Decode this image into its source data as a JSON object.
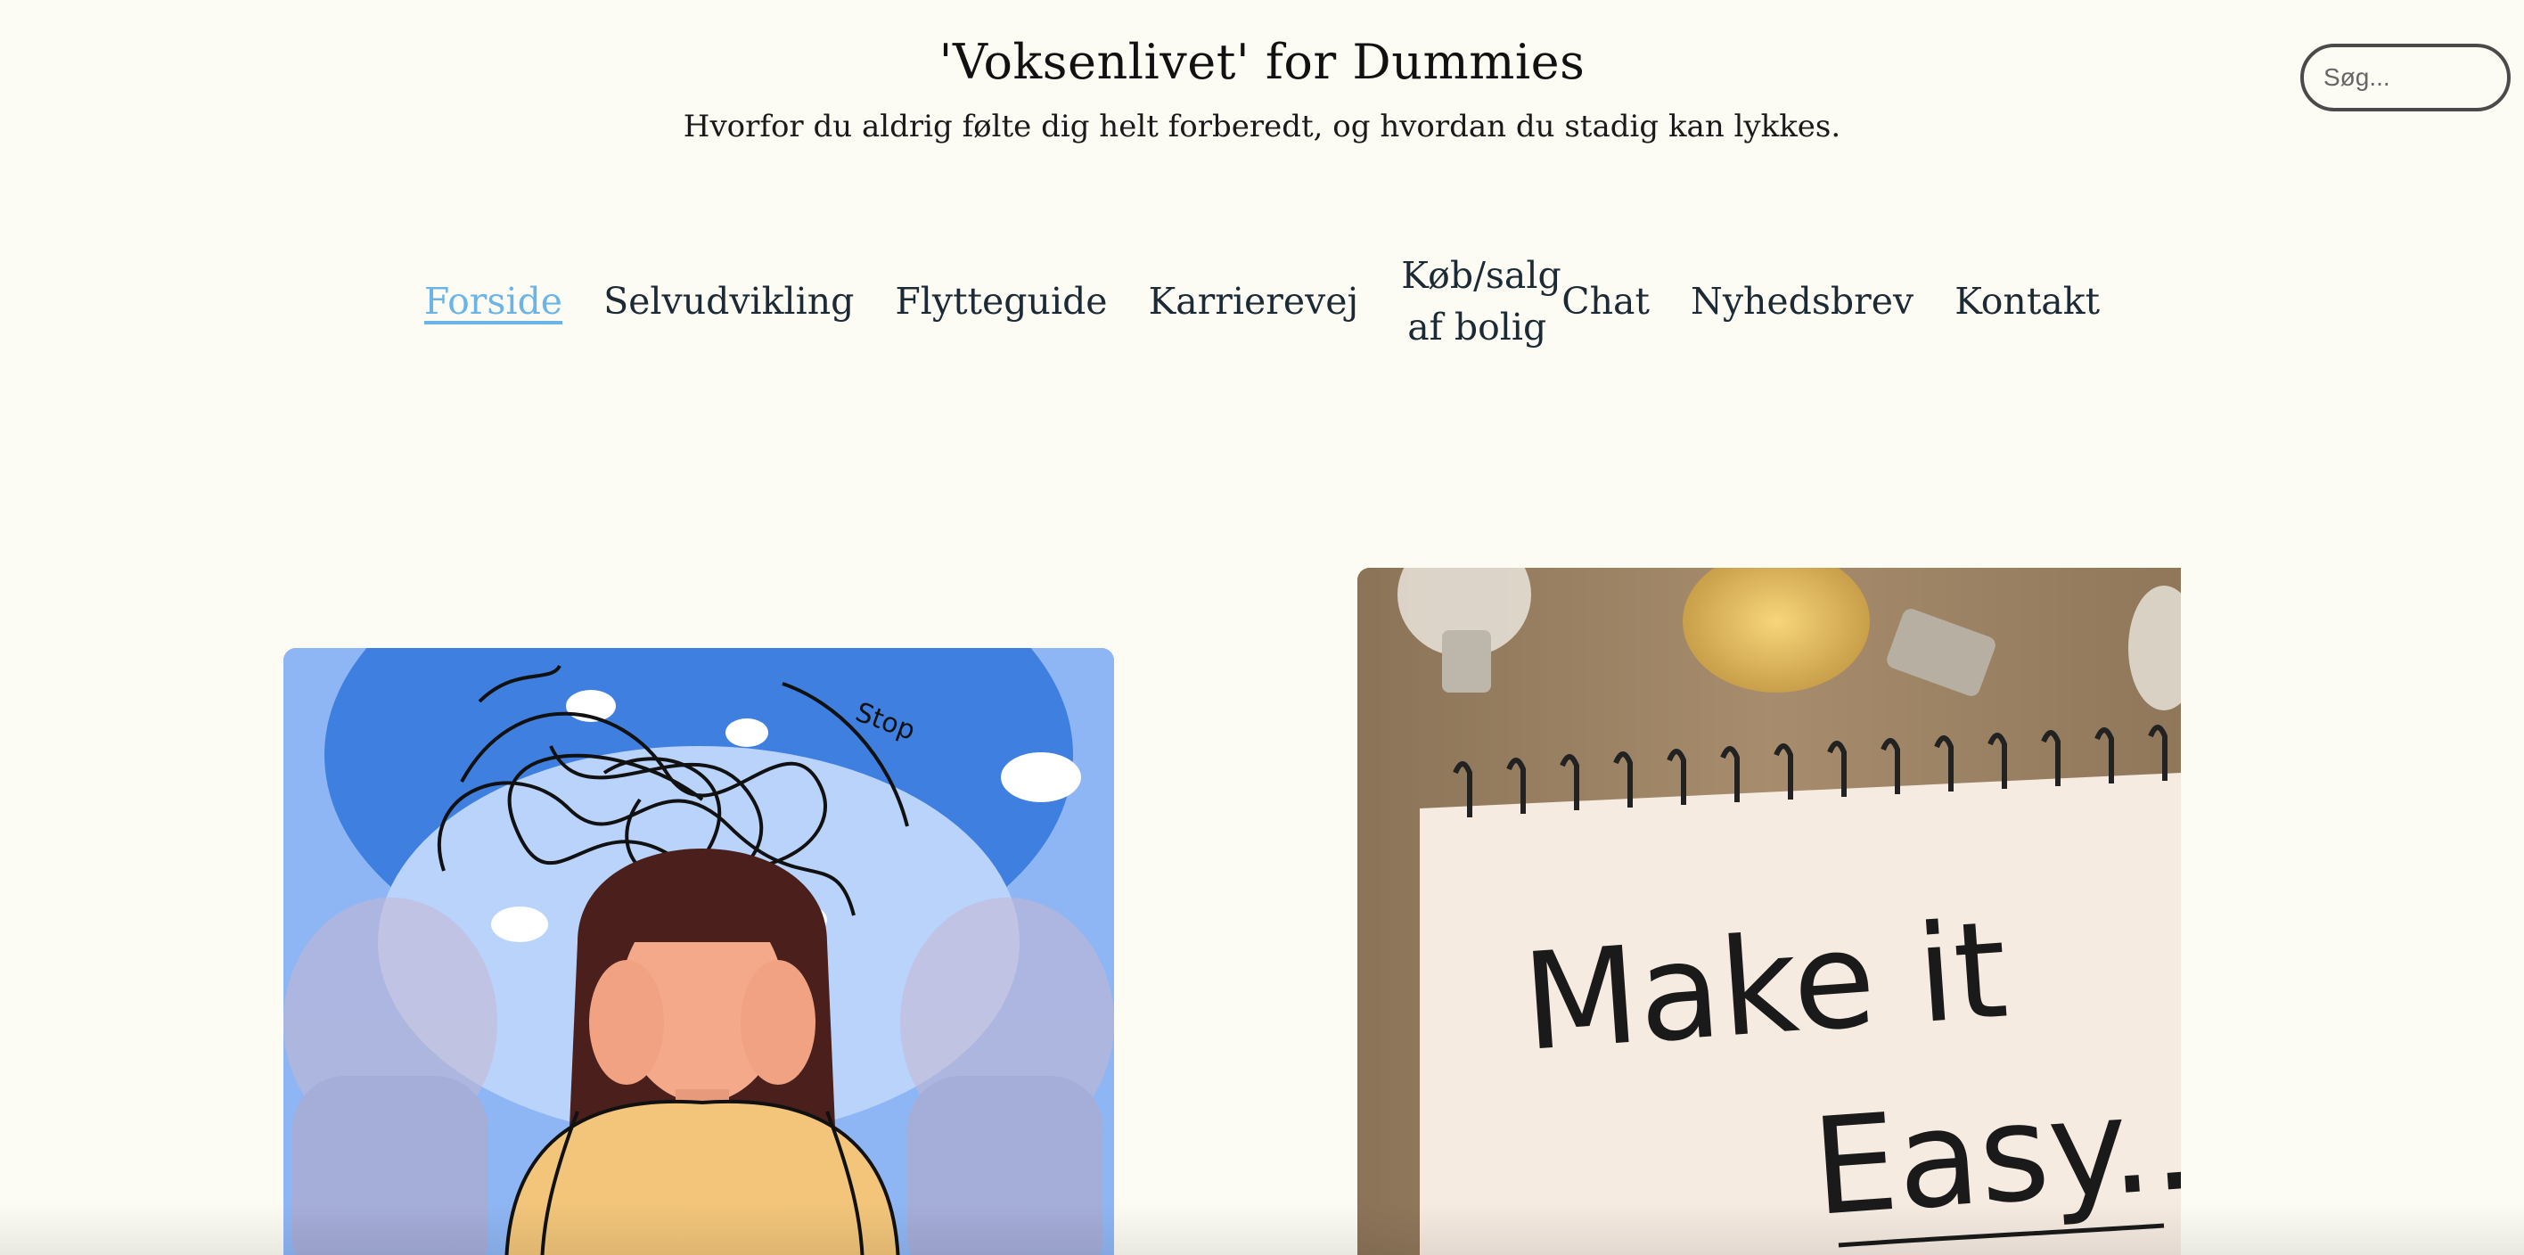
{
  "header": {
    "title": "'Voksenlivet' for Dummies",
    "subtitle": "Hvorfor du aldrig følte dig helt forberedt, og hvordan du stadig kan lykkes."
  },
  "search": {
    "placeholder": "Søg..."
  },
  "nav": {
    "items": [
      {
        "label": "Forside",
        "active": true
      },
      {
        "label": "Selvudvikling"
      },
      {
        "label": "Flytteguide"
      },
      {
        "label": "Karrierevej"
      },
      {
        "label": "Køb/salg af bolig"
      },
      {
        "label": "Chat"
      },
      {
        "label": "Nyhedsbrev"
      },
      {
        "label": "Kontakt"
      }
    ]
  },
  "cards": {
    "right_image_text_line1": "Make it",
    "right_image_text_line2": "Easy.."
  },
  "colors": {
    "background": "#fdfcf4",
    "nav_active": "#6cb4e6",
    "nav_text": "#1c2a36"
  }
}
